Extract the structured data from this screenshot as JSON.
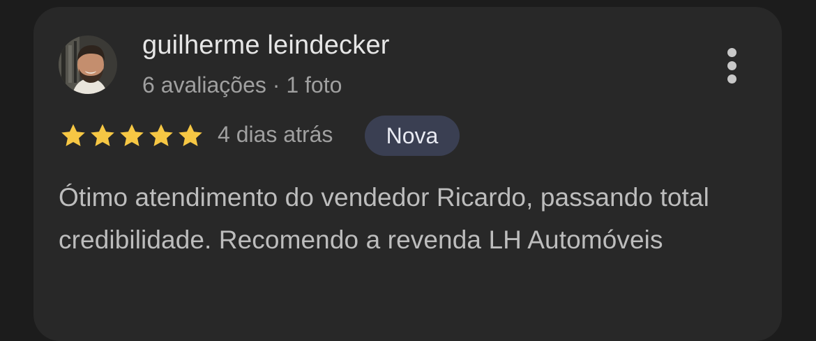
{
  "review": {
    "author_name": "guilherme leindecker",
    "author_meta": "6 avaliações · 1 foto",
    "rating": 5,
    "rating_max": 5,
    "time_ago": "4 dias atrás",
    "badge": "Nova",
    "text": "Ótimo atendimento do vendedor Ricardo, passando total credibilidade. Recomendo a revenda LH Automóveis"
  },
  "icons": {
    "menu": "more-vert-icon",
    "star": "star-icon",
    "avatar": "avatar"
  },
  "colors": {
    "background": "#1c1c1c",
    "card": "#282828",
    "star": "#f6c744",
    "badge_bg": "#3a3f52",
    "name": "#e6e6e6",
    "meta": "#a0a0a0",
    "body_text": "#bdbdbd"
  }
}
